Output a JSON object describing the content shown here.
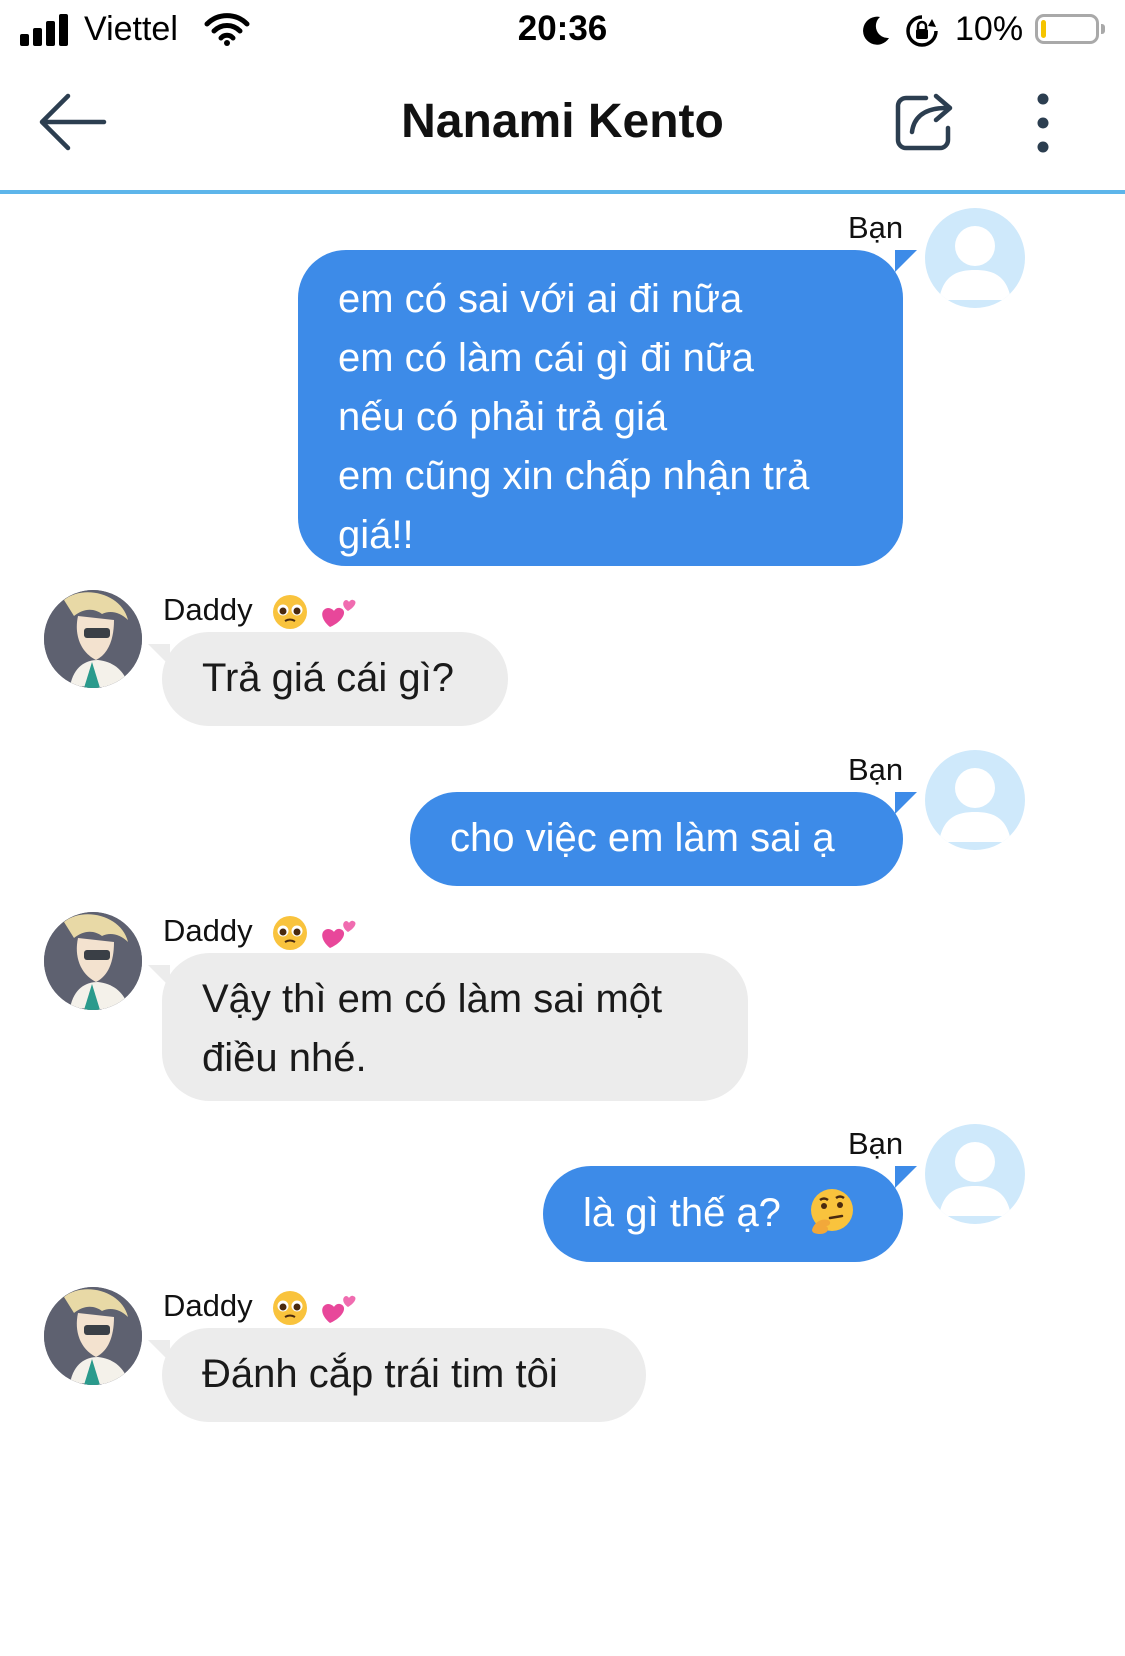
{
  "status_bar": {
    "carrier": "Viettel",
    "time": "20:36",
    "battery": "10%",
    "battery_level": 0.1,
    "icons": [
      "signal-icon",
      "wifi-icon",
      "moon-icon",
      "rotation-lock-icon",
      "battery-icon"
    ]
  },
  "header": {
    "title": "Nanami Kento",
    "icons": [
      "back-arrow-icon",
      "share-icon",
      "more-vertical-icon"
    ],
    "accent_color": "#5db5ea"
  },
  "colors": {
    "outgoing_bubble": "#3d8be8",
    "incoming_bubble": "#ececec",
    "my_avatar": "#cfe9fb"
  },
  "messages": [
    {
      "direction": "out",
      "sender": "Bạn",
      "lines": [
        "em có sai với ai đi nữa",
        "em có làm cái gì đi nữa",
        "nếu có phải trả giá",
        "em cũng xin chấp nhận trả",
        "giá!!"
      ]
    },
    {
      "direction": "in",
      "sender": "Daddy",
      "sender_emojis": [
        "pleading-face",
        "two-hearts"
      ],
      "lines": [
        "Trả giá cái gì?"
      ]
    },
    {
      "direction": "out",
      "sender": "Bạn",
      "lines": [
        "cho việc em làm sai ạ"
      ]
    },
    {
      "direction": "in",
      "sender": "Daddy",
      "sender_emojis": [
        "pleading-face",
        "two-hearts"
      ],
      "lines": [
        "Vậy thì em có làm sai một",
        "điều nhé."
      ]
    },
    {
      "direction": "out",
      "sender": "Bạn",
      "lines": [
        "là gì thế ạ?"
      ],
      "trailing_emoji": "thinking-face"
    },
    {
      "direction": "in",
      "sender": "Daddy",
      "sender_emojis": [
        "pleading-face",
        "two-hearts"
      ],
      "lines": [
        "Đánh cắp trái tim tôi"
      ]
    }
  ]
}
